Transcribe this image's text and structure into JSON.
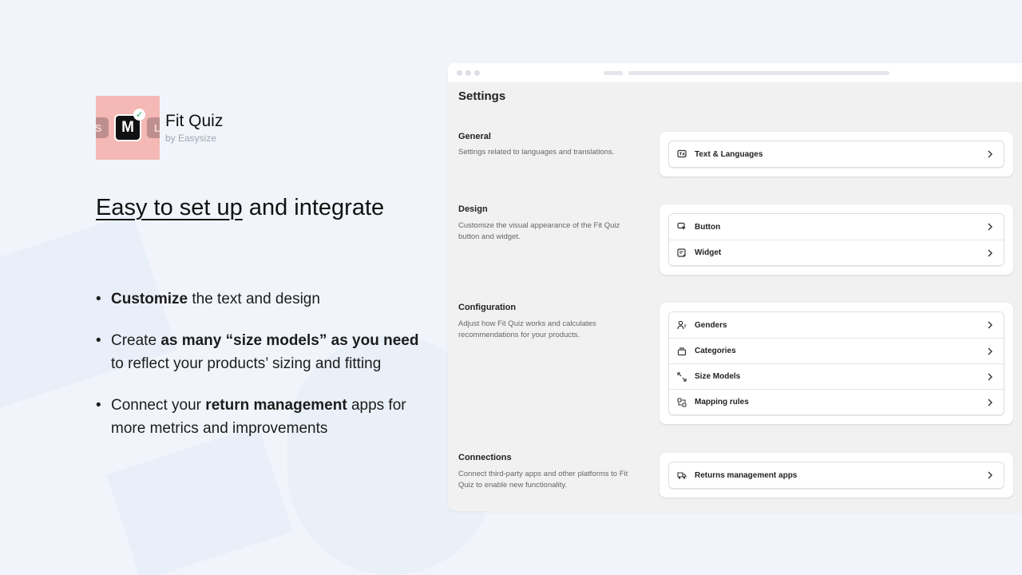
{
  "app": {
    "logo_letters": [
      "S",
      "M",
      "L"
    ],
    "name": "Fit Quiz",
    "by": "by Easysize"
  },
  "headline": {
    "underlined": "Easy to set up",
    "rest": " and integrate"
  },
  "bullets": [
    {
      "parts": [
        {
          "text": "Customize",
          "bold": true
        },
        {
          "text": " the text and design",
          "bold": false
        }
      ]
    },
    {
      "parts": [
        {
          "text": "Create ",
          "bold": false
        },
        {
          "text": "as many “size models” as you need",
          "bold": true
        },
        {
          "text": " to reflect your products’ sizing and fitting",
          "bold": false
        }
      ]
    },
    {
      "parts": [
        {
          "text": "Connect your ",
          "bold": false
        },
        {
          "text": "return management",
          "bold": true
        },
        {
          "text": " apps for more metrics and improvements",
          "bold": false
        }
      ]
    }
  ],
  "settings": {
    "title": "Settings",
    "sections": [
      {
        "title": "General",
        "description": "Settings related to languages and translations.",
        "items": [
          {
            "label": "Text & Languages",
            "icon": "translate-icon"
          }
        ]
      },
      {
        "title": "Design",
        "description": "Customize the visual appearance of the Fit Quiz button and widget.",
        "items": [
          {
            "label": "Button",
            "icon": "cursor-icon"
          },
          {
            "label": "Widget",
            "icon": "widget-icon"
          }
        ]
      },
      {
        "title": "Configuration",
        "description": "Adjust how Fit Quiz works and calculates recommendations for your products.",
        "items": [
          {
            "label": "Genders",
            "icon": "person-icon"
          },
          {
            "label": "Categories",
            "icon": "box-icon"
          },
          {
            "label": "Size Models",
            "icon": "resize-icon"
          },
          {
            "label": "Mapping rules",
            "icon": "mapping-icon"
          }
        ]
      },
      {
        "title": "Connections",
        "description": "Connect third-party apps and other platforms to Fit Quiz to enable new functionality.",
        "items": [
          {
            "label": "Returns management apps",
            "icon": "truck-icon"
          }
        ]
      }
    ]
  },
  "colors": {
    "page_bg": "#f1f5fb",
    "logo_bg": "#f4b8b5",
    "check_green": "#1fa35a"
  }
}
